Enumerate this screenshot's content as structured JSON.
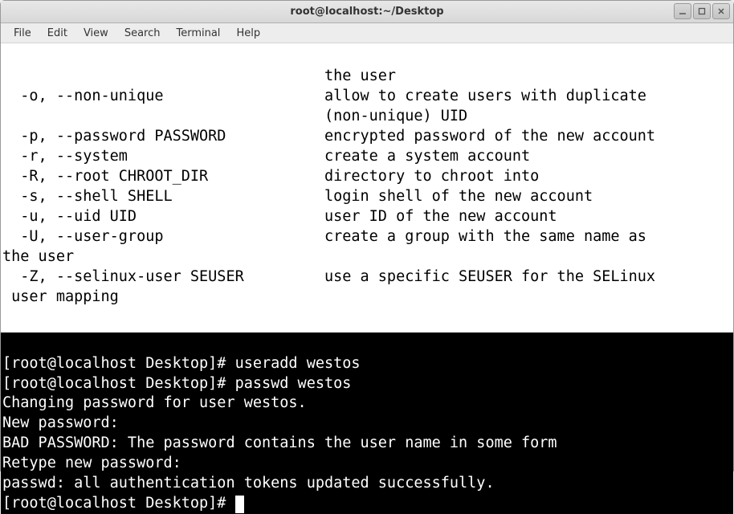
{
  "window": {
    "title": "root@localhost:~/Desktop"
  },
  "menu": {
    "file": "File",
    "edit": "Edit",
    "view": "View",
    "search": "Search",
    "terminal": "Terminal",
    "help": "Help"
  },
  "man": {
    "l01": "                                    the user",
    "l02": "  -o, --non-unique                  allow to create users with duplicate",
    "l03": "                                    (non-unique) UID",
    "l04": "  -p, --password PASSWORD           encrypted password of the new account",
    "l05": "  -r, --system                      create a system account",
    "l06": "  -R, --root CHROOT_DIR             directory to chroot into",
    "l07": "  -s, --shell SHELL                 login shell of the new account",
    "l08": "  -u, --uid UID                     user ID of the new account",
    "l09": "  -U, --user-group                  create a group with the same name as",
    "l10": "the user",
    "l11": "  -Z, --selinux-user SEUSER         use a specific SEUSER for the SELinux",
    "l12": " user mapping",
    "l13": ""
  },
  "shell": {
    "l01": "[root@localhost Desktop]# useradd westos",
    "l02": "[root@localhost Desktop]# passwd westos",
    "l03": "Changing password for user westos.",
    "l04": "New password: ",
    "l05": "BAD PASSWORD: The password contains the user name in some form",
    "l06": "Retype new password: ",
    "l07": "passwd: all authentication tokens updated successfully.",
    "l08": "[root@localhost Desktop]# "
  }
}
